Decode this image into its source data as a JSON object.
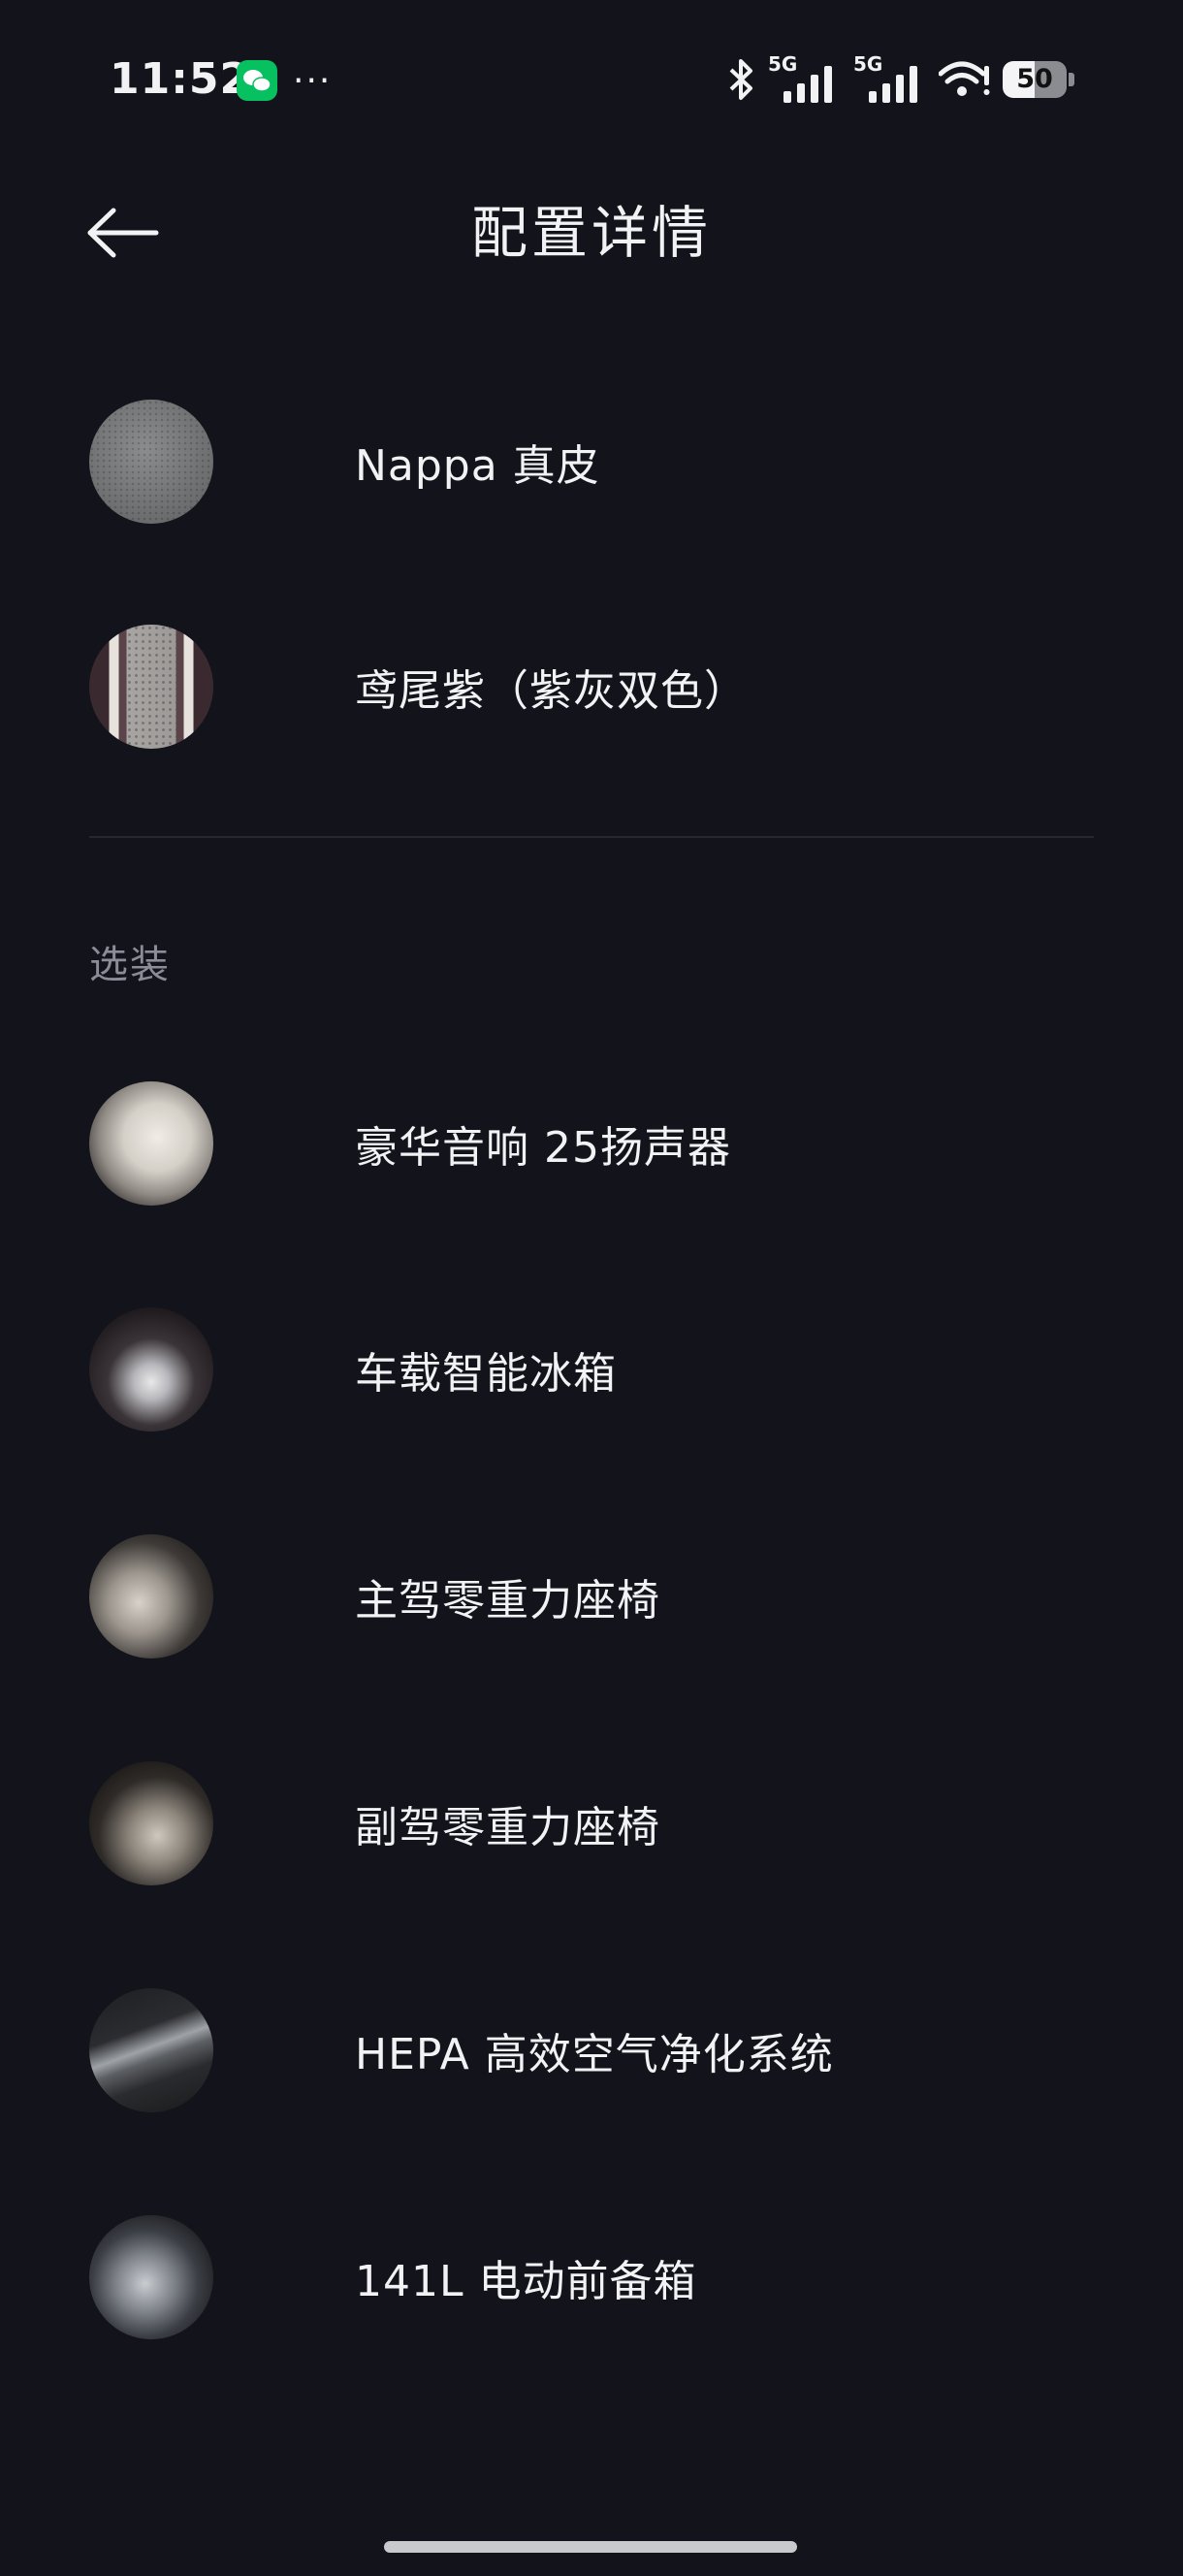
{
  "status_bar": {
    "time": "11:52",
    "more": "···",
    "network_1": "5G",
    "network_2": "5G",
    "battery_level": "50",
    "battery_fraction": 0.5,
    "wechat_color": "#07c160"
  },
  "header": {
    "title": "配置详情"
  },
  "selected": {
    "items": [
      {
        "label": "Nappa 真皮",
        "icon": "leather-swatch"
      },
      {
        "label": "鸢尾紫（紫灰双色）",
        "icon": "purple-gray-swatch"
      }
    ]
  },
  "options": {
    "section_label": "选装",
    "items": [
      {
        "label": "豪华音响 25扬声器",
        "icon": "speaker-photo"
      },
      {
        "label": "车载智能冰箱",
        "icon": "fridge-photo"
      },
      {
        "label": "主驾零重力座椅",
        "icon": "driver-seat-photo"
      },
      {
        "label": "副驾零重力座椅",
        "icon": "passenger-seat-photo"
      },
      {
        "label": "HEPA 高效空气净化系统",
        "icon": "air-filter-photo"
      },
      {
        "label": "141L 电动前备箱",
        "icon": "front-trunk-photo"
      }
    ]
  },
  "colors": {
    "background": "#13141b",
    "text": "#f2f2f4",
    "muted": "#8a8c98"
  }
}
